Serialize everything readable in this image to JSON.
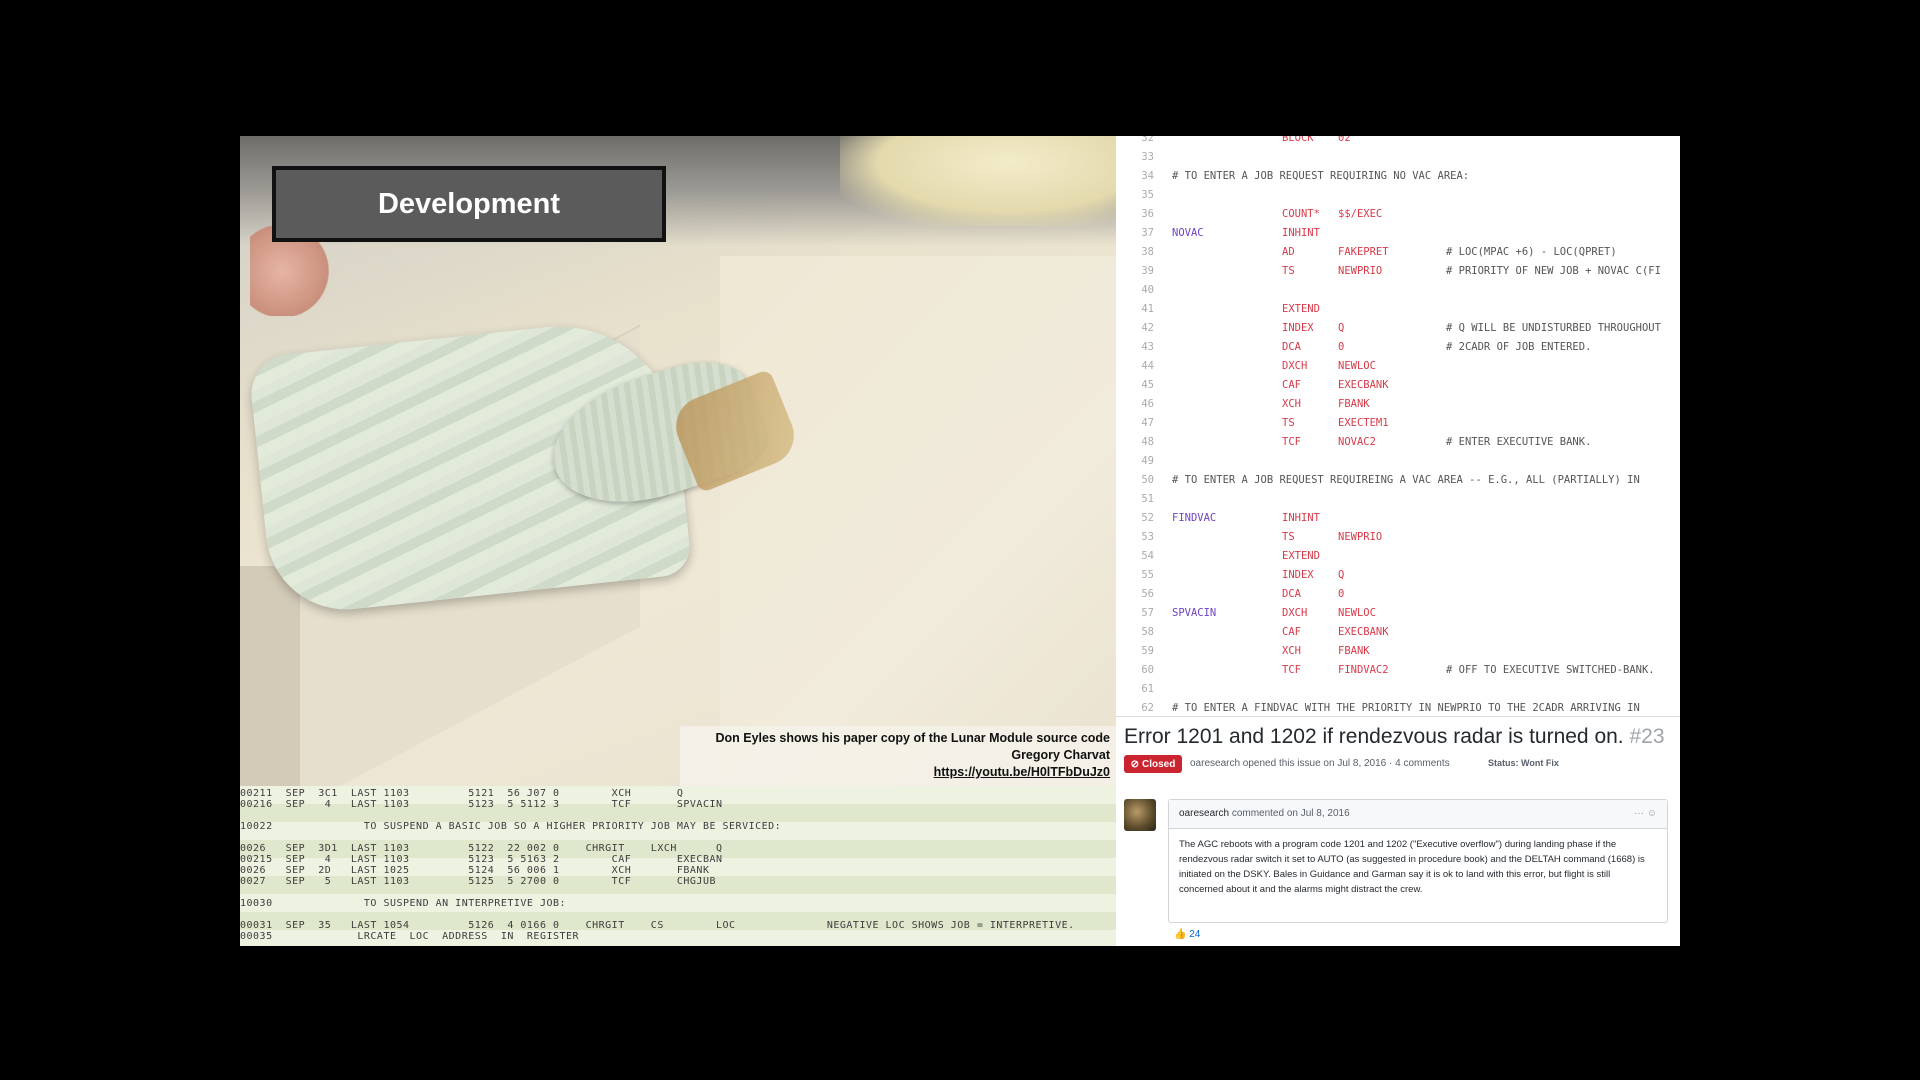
{
  "slide_title": "Development",
  "caption": {
    "line1": "Don Eyles shows his paper copy of the Lunar Module source code",
    "line2": "Gregory Charvat",
    "link": "https://youtu.be/H0lTFbDuJz0"
  },
  "listing_rows": [
    "00211  SEP  3C1  LAST 1103         5121  56 J07 0        XCH       Q",
    "00216  SEP   4   LAST 1103         5123  5 5112 3        TCF       SPVACIN",
    "",
    "10022              TO SUSPEND A BASIC JOB SO A HIGHER PRIORITY JOB MAY BE SERVICED:",
    "",
    "0026   SEP  3D1  LAST 1103         5122  22 002 0    CHRGIT    LXCH      Q",
    "00215  SEP   4   LAST 1103         5123  5 5163 2        CAF       EXECBAN",
    "0026   SEP  2D   LAST 1025         5124  56 006 1        XCH       FBANK",
    "0027   SEP   5   LAST 1103         5125  5 2700 0        TCF       CHGJUB",
    "",
    "10030              TO SUSPEND AN INTERPRETIVE JOB:",
    "",
    "00031  SEP  35   LAST 1054         5126  4 0166 0    CHRGIT    CS        LOC              NEGATIVE LOC SHOWS JOB = INTERPRETIVE.",
    "00035             LRCATE  LOC  ADDRESS  IN  REGISTER"
  ],
  "code_lines": [
    {
      "n": "32",
      "lbl": "",
      "op": "BLOCK",
      "arg": "02",
      "cmt": ""
    },
    {
      "n": "33",
      "lbl": "",
      "op": "",
      "arg": "",
      "cmt": ""
    },
    {
      "n": "34",
      "full": "# TO ENTER A JOB REQUEST REQUIRING NO VAC AREA:"
    },
    {
      "n": "35",
      "lbl": "",
      "op": "",
      "arg": "",
      "cmt": ""
    },
    {
      "n": "36",
      "lbl": "",
      "op": "COUNT*",
      "arg": "$$/EXEC",
      "cmt": ""
    },
    {
      "n": "37",
      "lbl": "NOVAC",
      "op": "INHINT",
      "arg": "",
      "cmt": ""
    },
    {
      "n": "38",
      "lbl": "",
      "op": "AD",
      "arg": "FAKEPRET",
      "cmt": "# LOC(MPAC +6) - LOC(QPRET)"
    },
    {
      "n": "39",
      "lbl": "",
      "op": "TS",
      "arg": "NEWPRIO",
      "cmt": "# PRIORITY OF NEW JOB + NOVAC C(FI"
    },
    {
      "n": "40",
      "lbl": "",
      "op": "",
      "arg": "",
      "cmt": ""
    },
    {
      "n": "41",
      "lbl": "",
      "op": "EXTEND",
      "arg": "",
      "cmt": ""
    },
    {
      "n": "42",
      "lbl": "",
      "op": "INDEX",
      "arg": "Q",
      "cmt": "# Q WILL BE UNDISTURBED THROUGHOUT"
    },
    {
      "n": "43",
      "lbl": "",
      "op": "DCA",
      "arg": "0",
      "cmt": "# 2CADR OF JOB ENTERED."
    },
    {
      "n": "44",
      "lbl": "",
      "op": "DXCH",
      "arg": "NEWLOC",
      "cmt": ""
    },
    {
      "n": "45",
      "lbl": "",
      "op": "CAF",
      "arg": "EXECBANK",
      "cmt": ""
    },
    {
      "n": "46",
      "lbl": "",
      "op": "XCH",
      "arg": "FBANK",
      "cmt": ""
    },
    {
      "n": "47",
      "lbl": "",
      "op": "TS",
      "arg": "EXECTEM1",
      "cmt": ""
    },
    {
      "n": "48",
      "lbl": "",
      "op": "TCF",
      "arg": "NOVAC2",
      "cmt": "# ENTER EXECUTIVE BANK."
    },
    {
      "n": "49",
      "lbl": "",
      "op": "",
      "arg": "",
      "cmt": ""
    },
    {
      "n": "50",
      "full": "# TO ENTER A JOB REQUEST REQUIREING A VAC AREA -- E.G., ALL (PARTIALLY) IN"
    },
    {
      "n": "51",
      "lbl": "",
      "op": "",
      "arg": "",
      "cmt": ""
    },
    {
      "n": "52",
      "lbl": "FINDVAC",
      "op": "INHINT",
      "arg": "",
      "cmt": ""
    },
    {
      "n": "53",
      "lbl": "",
      "op": "TS",
      "arg": "NEWPRIO",
      "cmt": ""
    },
    {
      "n": "54",
      "lbl": "",
      "op": "EXTEND",
      "arg": "",
      "cmt": ""
    },
    {
      "n": "55",
      "lbl": "",
      "op": "INDEX",
      "arg": "Q",
      "cmt": ""
    },
    {
      "n": "56",
      "lbl": "",
      "op": "DCA",
      "arg": "0",
      "cmt": ""
    },
    {
      "n": "57",
      "lbl": "SPVACIN",
      "op": "DXCH",
      "arg": "NEWLOC",
      "cmt": ""
    },
    {
      "n": "58",
      "lbl": "",
      "op": "CAF",
      "arg": "EXECBANK",
      "cmt": ""
    },
    {
      "n": "59",
      "lbl": "",
      "op": "XCH",
      "arg": "FBANK",
      "cmt": ""
    },
    {
      "n": "60",
      "lbl": "",
      "op": "TCF",
      "arg": "FINDVAC2",
      "cmt": "# OFF TO EXECUTIVE SWITCHED-BANK."
    },
    {
      "n": "61",
      "lbl": "",
      "op": "",
      "arg": "",
      "cmt": ""
    },
    {
      "n": "62",
      "full": "# TO ENTER A FINDVAC WITH THE PRIORITY IN NEWPRIO TO THE 2CADR ARRIVING IN"
    }
  ],
  "issue": {
    "title": "Error 1201 and 1202 if rendezvous radar is turned on.",
    "number": "#23",
    "badge": "Closed",
    "meta": "oaresearch opened this issue on Jul 8, 2016 · 4 comments",
    "status": "Status: Wont Fix",
    "comment_author": "oaresearch",
    "comment_head": "commented on Jul 8, 2016",
    "comment_body": "The AGC reboots with a program code 1201 and 1202 (\"Executive overflow\") during landing phase if the rendezvous radar switch it set to AUTO (as suggested in procedure book) and the DELTAH command (1668) is initiated on the DSKY. Bales in Guidance and Garman say it is ok to land with this error, but flight is still concerned about it and the alarms might distract the crew.",
    "reaction_count": "24"
  }
}
